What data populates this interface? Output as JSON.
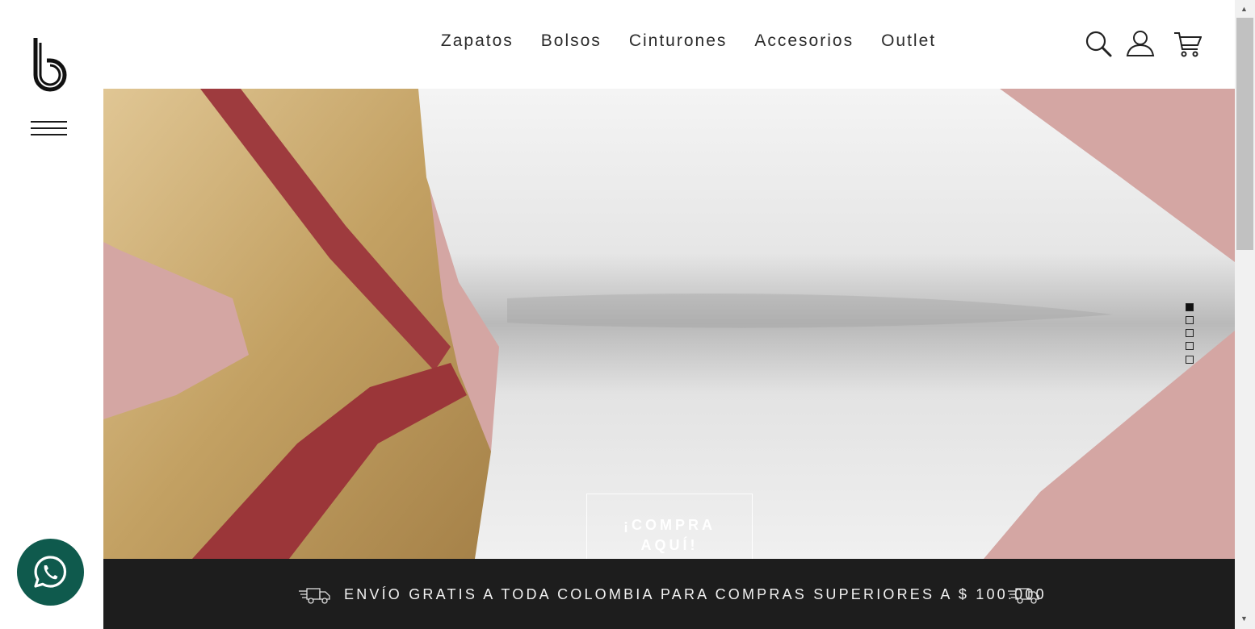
{
  "brand": {
    "logo_icon": "brand-b-logo"
  },
  "sidebar": {
    "menu_icon": "hamburger-icon"
  },
  "nav": {
    "items": [
      {
        "label": "Zapatos"
      },
      {
        "label": "Bolsos"
      },
      {
        "label": "Cinturones"
      },
      {
        "label": "Accesorios"
      },
      {
        "label": "Outlet"
      }
    ]
  },
  "header_icons": [
    "search-icon",
    "user-icon",
    "cart-icon"
  ],
  "hero": {
    "cta_label": "¡COMPRA AQUÍ!",
    "slide_count": 5,
    "active_slide": 1,
    "colors": {
      "background": "#d4a6a3",
      "gold": "#c9a869",
      "red": "#9e3b3e",
      "white_fabric": "#ececec"
    }
  },
  "promo": {
    "text": "ENVÍO GRATIS A TODA COLOMBIA PARA COMPRAS SUPERIORES A $ 100.000",
    "icon": "delivery-truck-icon",
    "background": "#1d1d1d"
  },
  "whatsapp": {
    "icon": "whatsapp-icon",
    "color": "#0f5a4d"
  }
}
